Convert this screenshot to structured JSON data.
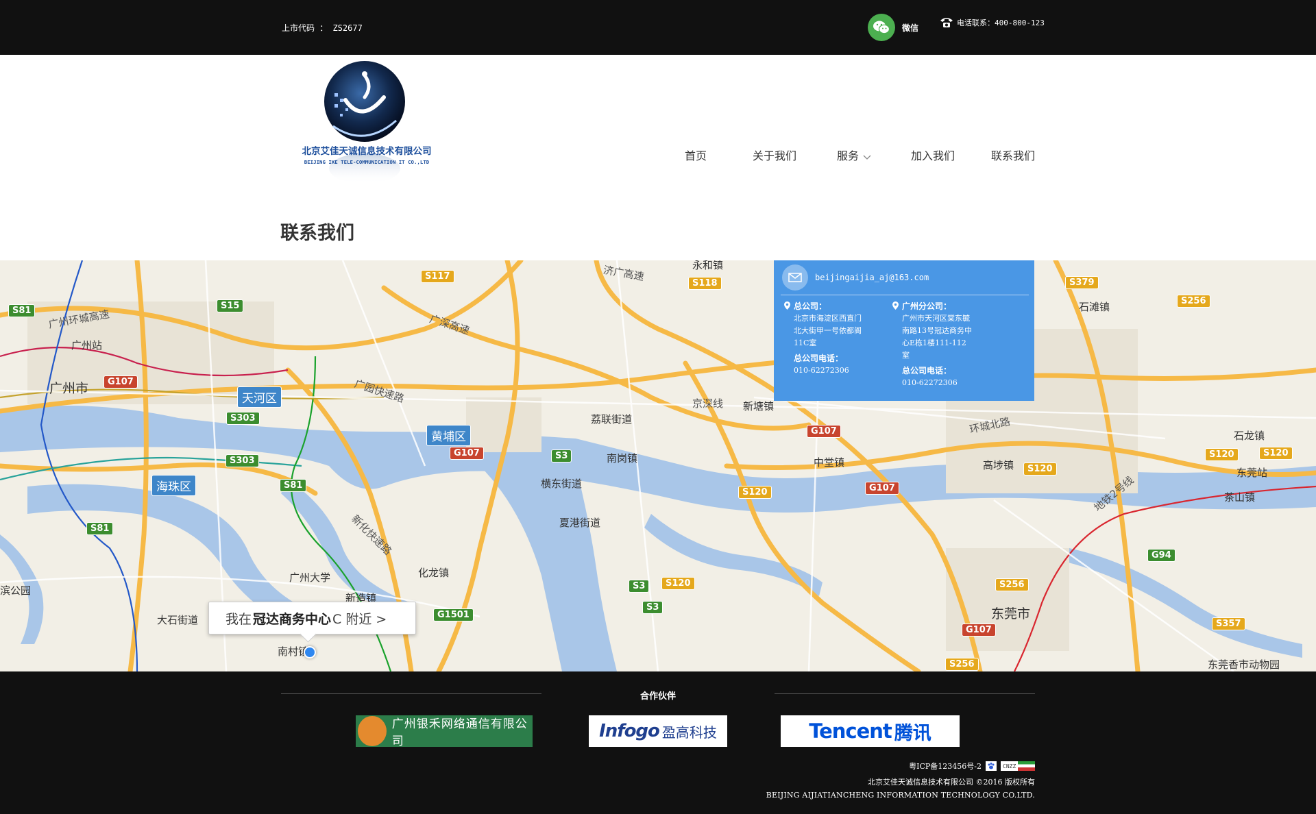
{
  "topbar": {
    "stock_code": "上市代码 ： ZS2677",
    "wechat_label": "微信",
    "phone_text": "电话联系：400-800-123"
  },
  "logo": {
    "company_cn": "北京艾佳天诚信息技术有限公司",
    "company_en": "BEIJING IKE TELE-COMMUNICATION IT CO.,LTD"
  },
  "nav": {
    "items": [
      {
        "label": "首页"
      },
      {
        "label": "关于我们"
      },
      {
        "label": "服务",
        "icon": "chevron-down-icon"
      },
      {
        "label": "加入我们"
      },
      {
        "label": "联系我们"
      }
    ]
  },
  "page": {
    "title": "联系我们"
  },
  "map": {
    "poi": {
      "prefix": "我在",
      "name": "冠达商务中心",
      "suffix": "C 附近 >"
    },
    "places": [
      "广州站",
      "广州市",
      "天河区",
      "黄埔区",
      "海珠区",
      "广州大学",
      "化龙镇",
      "新造镇",
      "大石街道",
      "南村镇",
      "荔联街道",
      "南岗镇",
      "横东街道",
      "夏港街道",
      "永和镇",
      "新塘镇",
      "中堂镇",
      "高埗镇",
      "东莞市",
      "石滩镇",
      "石龙镇",
      "东莞站",
      "茶山镇",
      "东莞香市动物园",
      "滨公园"
    ],
    "roads": [
      "广州环城高速",
      "广深高速",
      "济广高速",
      "广园快速路",
      "京深线",
      "环城北路",
      "新化快速路",
      "地铁2号线"
    ],
    "route_shields": [
      "S81",
      "S15",
      "S117",
      "S118",
      "G107",
      "S303",
      "S3",
      "G1501",
      "S120",
      "S256",
      "S379",
      "G94",
      "S357"
    ],
    "colors": {
      "water": "#a9c6e8",
      "land": "#f2efe6",
      "highway": "#f6b946",
      "district_tag": "#3e86c9"
    }
  },
  "contact": {
    "email": "beijingaijia_aj@163.com",
    "hq": {
      "heading": "总公司：",
      "address": "北京市海淀区西直门北大街甲一号依都阁11C室",
      "phone_heading": "总公司电话：",
      "phone": "010-62272306"
    },
    "branch": {
      "heading": "广州分公司：",
      "address": "广州市天河区棠东毓南路13号冠达商务中心E栋1楼111-112室",
      "phone_heading": "总公司电话：",
      "phone": "010-62272306"
    },
    "accent": "#4a97e5"
  },
  "footer": {
    "partners_title": "合作伙伴",
    "partners": [
      {
        "name": "广州银禾网络通信有限公司"
      },
      {
        "name_en": "Infogo",
        "name_cn": "盈高科技"
      },
      {
        "name_en": "Tencent",
        "name_cn": "腾讯"
      }
    ],
    "icp": "粤ICP备123456号-2",
    "cnzz": "CNZZ",
    "copyright": "北京艾佳天诚信息技术有限公司 ©2016 版权所有",
    "company_en": "BEIJING  AIJIATIANCHENG INFORMATION TECHNOLOGY CO.LTD."
  }
}
